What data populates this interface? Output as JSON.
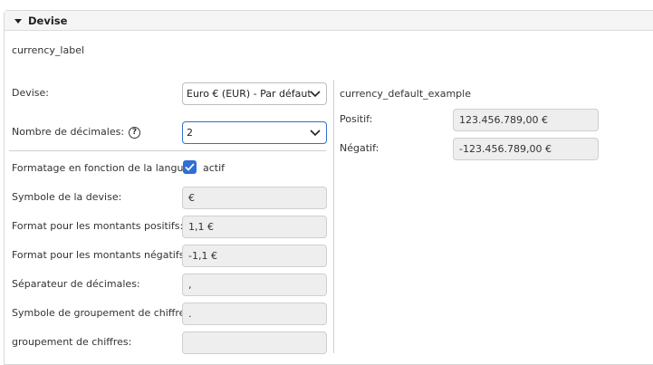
{
  "section": {
    "title": "Devise",
    "subtitle": "currency_label"
  },
  "form": {
    "devise_label": "Devise:",
    "devise_value": "Euro € (EUR) - Par défaut",
    "decimals_label": "Nombre de décimales:",
    "decimals_value": "2",
    "locale_format_label": "Formatage en fonction de la langue:",
    "locale_format_checkbox_label": "actif",
    "locale_format_checked": true,
    "symbol_label": "Symbole de la devise:",
    "symbol_value": "€",
    "positive_format_label": "Format pour les montants positifs:",
    "positive_format_value": "1,1 €",
    "negative_format_label": "Format pour les montants négatifs:",
    "negative_format_value": "-1,1 €",
    "decimal_separator_label": "Séparateur de décimales:",
    "decimal_separator_value": ",",
    "grouping_symbol_label": "Symbole de groupement de chiffres:",
    "grouping_symbol_value": ".",
    "grouping_label": "groupement de chiffres:",
    "grouping_value": ""
  },
  "example": {
    "title": "currency_default_example",
    "positive_label": "Positif:",
    "positive_value": "123.456.789,00 €",
    "negative_label": "Négatif:",
    "negative_value": "-123.456.789,00 €"
  },
  "colors": {
    "accent": "#2f6fd6",
    "readonly_bg": "#eeeeee",
    "header_bg": "#f5f5f5"
  }
}
